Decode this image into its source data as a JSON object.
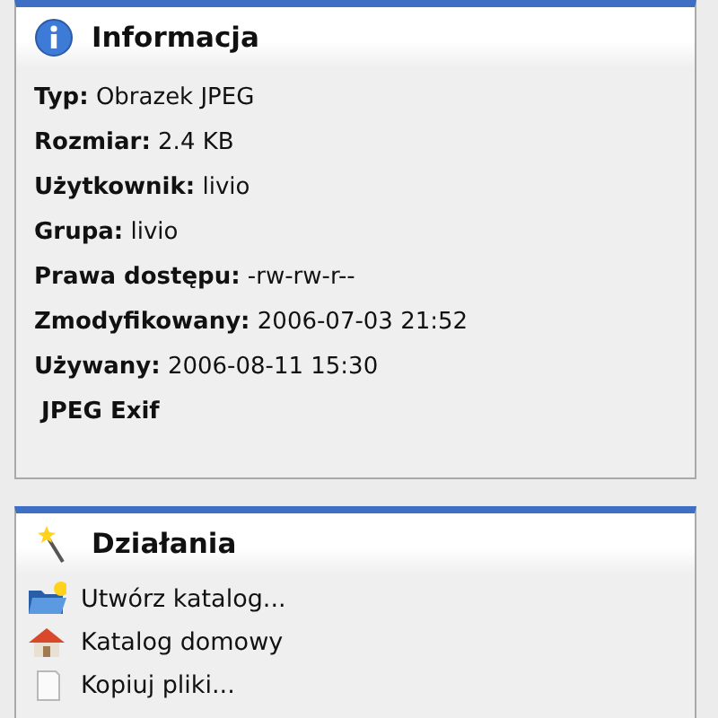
{
  "info_panel": {
    "title": "Informacja",
    "details": [
      "**Typ:** Obrazek JPEG",
      "**Rozmiar:** 2.4 KB",
      "**Użytkownik:** livio",
      "**Grupa:** livio",
      "**Prawa dostępu:** -rw-rw-r--",
      "**Zmodyfikowany:** 2006-07-03 21:52",
      "**Używany:** 2006-08-11 15:30"
    ],
    "section_label": "JPEG Exif"
  },
  "actions_panel": {
    "title": "Działania",
    "items": [
      {
        "kind": "new-folder",
        "label": "Utwórz katalog..."
      },
      {
        "kind": "home",
        "label": "Katalog domowy"
      },
      {
        "kind": "copy",
        "label": "Kopiuj pliki..."
      }
    ]
  }
}
